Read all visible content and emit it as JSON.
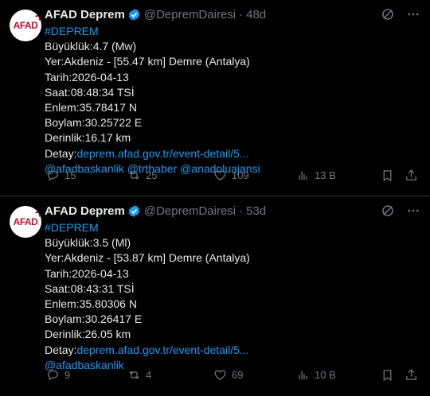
{
  "colors": {
    "background": "#000000",
    "text": "#e7e9ea",
    "muted": "#71767b",
    "link": "#1d9bf0",
    "verified": "#1d9bf0",
    "divider": "#2f3336"
  },
  "tweets": [
    {
      "author_name": "AFAD Deprem",
      "handle": "@DepremDairesi",
      "separator": "·",
      "time": "48d",
      "avatar_text": "AFAD",
      "hashtag": "#DEPREM",
      "lines": [
        "Büyüklük:4.7 (Mw)",
        "Yer:Akdeniz - [55.47 km] Demre (Antalya)",
        "Tarih:2026-04-13",
        "Saat:08:48:34 TSİ",
        "Enlem:35.78417 N",
        "Boylam:30.25722 E",
        "Derinlik:16.17 km"
      ],
      "detail_label": "Detay:",
      "detail_link": "deprem.afad.gov.tr/event-detail/5...",
      "mentions": "@afadbaskanlik @trthaber @anadoluajansi",
      "replies": "15",
      "retweets": "25",
      "likes": "109",
      "views": "13 B"
    },
    {
      "author_name": "AFAD Deprem",
      "handle": "@DepremDairesi",
      "separator": "·",
      "time": "53d",
      "avatar_text": "AFAD",
      "hashtag": "#DEPREM",
      "lines": [
        "Büyüklük:3.5 (Ml)",
        "Yer:Akdeniz - [53.87 km] Demre (Antalya)",
        "Tarih:2026-04-13",
        "Saat:08:43:31 TSİ",
        "Enlem:35.80306 N",
        "Boylam:30.26417 E",
        "Derinlik:26.05 km"
      ],
      "detail_label": "Detay:",
      "detail_link": "deprem.afad.gov.tr/event-detail/5...",
      "mentions": "@afadbaskanlik",
      "replies": "9",
      "retweets": "4",
      "likes": "69",
      "views": "10 B"
    }
  ]
}
